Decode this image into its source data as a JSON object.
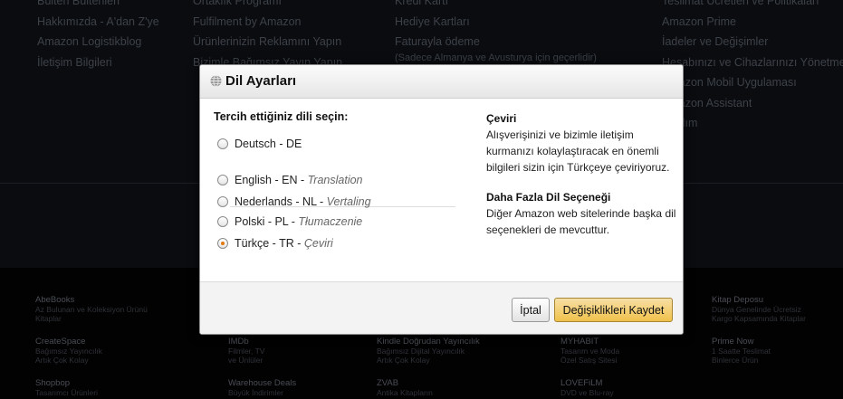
{
  "background": {
    "columns": [
      [
        "Bülten Bültenleri",
        "Hakkımızda - A'dan Z'ye",
        "Amazon Logistikblog",
        "İletişim Bilgileri"
      ],
      [
        "Ortaklık Programı",
        "Fulfilment by Amazon",
        "Ürünlerinizin Reklamını Yapın",
        "Bizimle Bağımsız Yayın Yapın"
      ],
      [
        "Kredi Kartı",
        "Hediye Kartları",
        "Faturayla ödeme",
        "(Sadece Almanya ve Avusturya için geçerlidir)"
      ],
      [
        "Teslimat Ücretleri ve Politikaları",
        "Amazon Prime",
        "İadeler ve Değişimler",
        "Hesabınızı ve Cihazlarınızı Yönetme",
        "Amazon Mobil Uygulaması",
        "Amazon Assistant",
        "Yardım"
      ]
    ],
    "services": [
      {
        "title": "AbeBooks",
        "desc": [
          "Az Bulunan ve Koleksiyon Ürünü",
          "Kitaplar"
        ]
      },
      {
        "title": "CreateSpace",
        "desc": [
          "Bağımsız Yayıncılık",
          "Artık Çok Kolay"
        ]
      },
      {
        "title": "Shopbop",
        "desc": [
          "Tasarımcı Ürünleri"
        ]
      },
      {
        "title": "IMDb",
        "desc": [
          "Filmler, TV",
          "ve Ünlüler"
        ]
      },
      {
        "title": "Warehouse Deals",
        "desc": [
          "Büyük İndirimler"
        ]
      },
      {
        "title": "Kindle Doğrudan Yayıncılık",
        "desc": [
          "Bağımsız Dijital Yayıncılık",
          "Artık Çok Kolay"
        ]
      },
      {
        "title": "ZVAB",
        "desc": [
          "Antika Kitapların"
        ]
      },
      {
        "title": "MYHABIT",
        "desc": [
          "Tasarım ve Moda",
          "Özel Satış Sitesi"
        ]
      },
      {
        "title": "LOVEFiLM",
        "desc": [
          "DVD ve Blu-ray"
        ]
      },
      {
        "title": "Kitap Deposu",
        "desc": [
          "Dünya Genelinde Ücretsiz",
          "Kargo Kapsamında Kitaplar"
        ]
      },
      {
        "title": "Prime Now",
        "desc": [
          "1 Saatte Teslimat",
          "Binlerce Ürün"
        ]
      }
    ]
  },
  "modal": {
    "title": "Dil Ayarları",
    "prompt": "Tercih ettiğiniz dili seçin:",
    "languages": [
      {
        "label": "Deutsch - DE",
        "native": "",
        "selected": false
      },
      {
        "label": "English - EN",
        "native": "Translation",
        "selected": false
      },
      {
        "label": "Nederlands - NL",
        "native": "Vertaling",
        "selected": false
      },
      {
        "label": "Polski - PL",
        "native": "Tłumaczenie",
        "selected": false
      },
      {
        "label": "Türkçe - TR",
        "native": "Çeviri",
        "selected": true
      }
    ],
    "info": {
      "heading1": "Çeviri",
      "text1": "Alışverişinizi ve bizimle iletişim kurmanızı kolaylaştıracak en önemli bilgileri sizin için Türkçeye çeviriyoruz.",
      "heading2": "Daha Fazla Dil Seçeneği",
      "text2": "Diğer Amazon web sitelerinde başka dil seçenekleri de mevcuttur."
    },
    "buttons": {
      "cancel": "İptal",
      "save": "Değişiklikleri Kaydet"
    }
  },
  "colors": {
    "accent": "#e47911",
    "save_button": "#f0c14b"
  }
}
